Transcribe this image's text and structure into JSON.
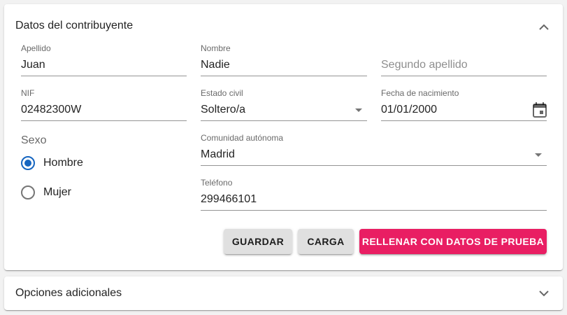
{
  "datos_panel": {
    "title": "Datos del contribuyente",
    "fields": {
      "apellido": {
        "label": "Apellido",
        "value": "Juan"
      },
      "nombre": {
        "label": "Nombre",
        "value": "Nadie"
      },
      "segundo_apellido": {
        "placeholder": "Segundo apellido",
        "value": ""
      },
      "nif": {
        "label": "NIF",
        "value": "02482300W"
      },
      "estado_civil": {
        "label": "Estado civil",
        "value": "Soltero/a"
      },
      "fecha_nacimiento": {
        "label": "Fecha de nacimiento",
        "value": "01/01/2000"
      },
      "comunidad": {
        "label": "Comunidad autónoma",
        "value": "Madrid"
      },
      "telefono": {
        "label": "Teléfono",
        "value": "299466101"
      }
    },
    "sexo": {
      "label": "Sexo",
      "options": [
        {
          "label": "Hombre",
          "selected": true
        },
        {
          "label": "Mujer",
          "selected": false
        }
      ]
    },
    "buttons": {
      "guardar": "GUARDAR",
      "carga": "CARGA",
      "rellenar": "RELLENAR CON DATOS DE PRUEBA"
    }
  },
  "opciones_panel": {
    "title": "Opciones adicionales"
  },
  "colors": {
    "accent": "#e91e63",
    "radio": "#1565c0",
    "button_grey": "#e0e0e0"
  }
}
